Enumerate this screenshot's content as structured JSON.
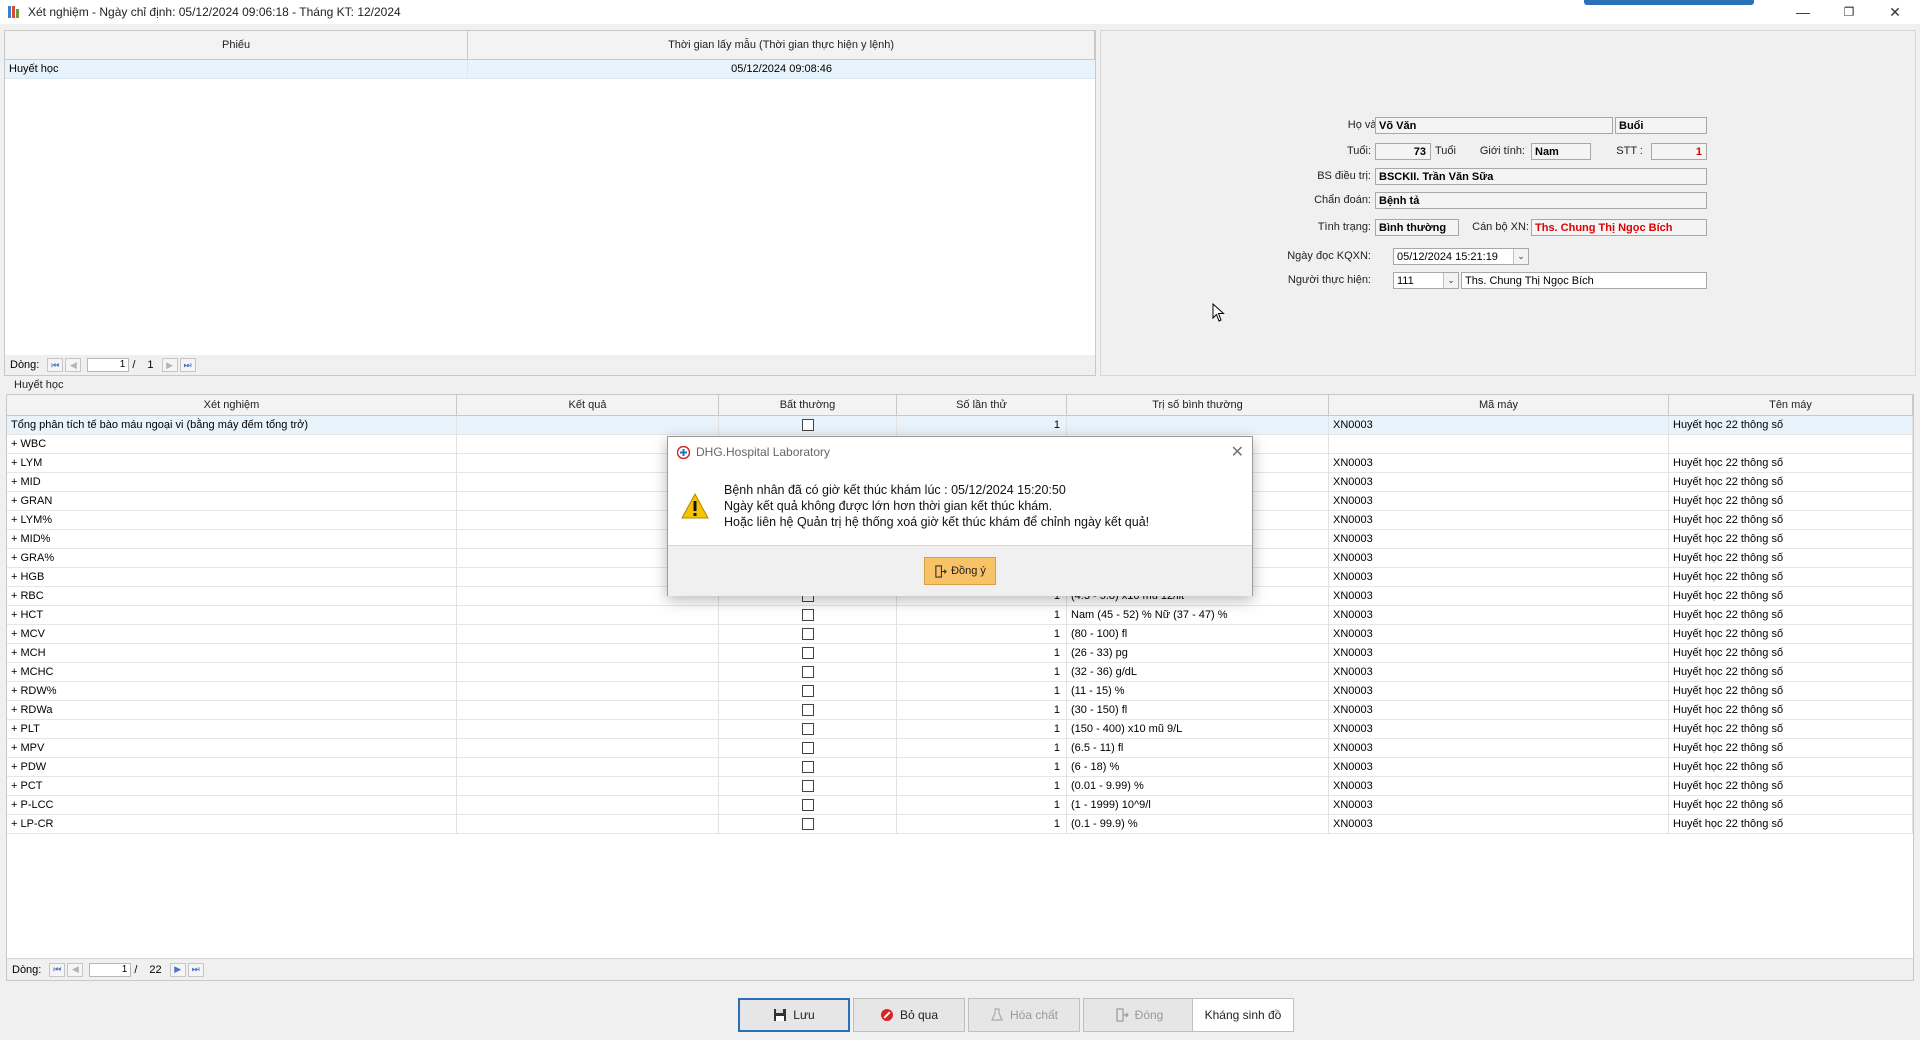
{
  "window": {
    "title": "Xét nghiệm - Ngày chỉ định: 05/12/2024 09:06:18 - Tháng KT: 12/2024",
    "minimize": "—",
    "restore": "❐",
    "close": "✕"
  },
  "top_grid": {
    "columns": [
      "Phiếu",
      "Thời gian lấy mẫu (Thời gian thực hiện y lệnh)"
    ],
    "rows": [
      {
        "phieu": "Huyết học",
        "time": "05/12/2024 09:08:46"
      }
    ],
    "pager": {
      "label": "Dòng:",
      "current": "1",
      "sep": "/",
      "total": "1"
    }
  },
  "patient": {
    "name_label": "Họ và tên :",
    "name": "Võ Văn",
    "session": "Buổi",
    "age_label": "Tuổi:",
    "age": "73",
    "age_unit": "Tuổi",
    "gender_label": "Giới tính:",
    "gender": "Nam",
    "stt_label": "STT :",
    "stt": "1",
    "doctor_label": "BS điều trị:",
    "doctor": "BSCKII. Trần Văn Sữa",
    "diagnosis_label": "Chẩn đoán:",
    "diagnosis": "Bệnh tả",
    "status_label": "Tình trạng:",
    "status": "Bình thường",
    "staff_label": "Cán bộ XN:",
    "staff": "Ths. Chung Thị Ngọc Bích",
    "read_date_label": "Ngày đọc KQXN:",
    "read_date": "05/12/2024  15:21:19",
    "performer_label": "Người thực hiện:",
    "performer_code": "111",
    "performer_name": "Ths. Chung Thị Ngọc Bích"
  },
  "section_label": "Huyết học",
  "main_grid": {
    "columns": [
      "Xét nghiệm",
      "Kết quả",
      "Bất thường",
      "Số lần thử",
      "Trị số bình thường",
      "Mã máy",
      "Tên máy"
    ],
    "rows": [
      {
        "test": "Tổng phân tích tế bào máu ngoại vi (bằng máy đếm tổng trở)",
        "count": "1",
        "normal": "",
        "machine": "XN0003",
        "machine_name": "Huyết học 22 thông số",
        "check": true
      },
      {
        "test": "+ WBC",
        "count": "",
        "normal": "",
        "machine": "",
        "machine_name": "",
        "check": false
      },
      {
        "test": "+ LYM",
        "count": "",
        "normal": "",
        "machine": "XN0003",
        "machine_name": "Huyết học 22 thông số",
        "check": false
      },
      {
        "test": "+ MID",
        "count": "",
        "normal": "",
        "machine": "XN0003",
        "machine_name": "Huyết học 22 thông số",
        "check": false
      },
      {
        "test": "+ GRAN",
        "count": "",
        "normal": "",
        "machine": "XN0003",
        "machine_name": "Huyết học 22 thông số",
        "check": false
      },
      {
        "test": "+ LYM%",
        "count": "",
        "normal": "",
        "machine": "XN0003",
        "machine_name": "Huyết học 22 thông số",
        "check": false
      },
      {
        "test": "+ MID%",
        "count": "",
        "normal": "",
        "machine": "XN0003",
        "machine_name": "Huyết học 22 thông số",
        "check": false
      },
      {
        "test": "+ GRA%",
        "count": "",
        "normal": "",
        "machine": "XN0003",
        "machine_name": "Huyết học 22 thông số",
        "check": false
      },
      {
        "test": "+ HGB",
        "count": "",
        "normal": "",
        "machine": "XN0003",
        "machine_name": "Huyết học 22 thông số",
        "check": false
      },
      {
        "test": "+ RBC",
        "count": "1",
        "normal": "(4.3 - 5.8) x10 mũ 12/lit",
        "machine": "XN0003",
        "machine_name": "Huyết học 22 thông số",
        "check": true
      },
      {
        "test": "+ HCT",
        "count": "1",
        "normal": "Nam (45 - 52) %  Nữ (37 - 47) %",
        "machine": "XN0003",
        "machine_name": "Huyết học 22 thông số",
        "check": true
      },
      {
        "test": "+ MCV",
        "count": "1",
        "normal": "(80 - 100) fl",
        "machine": "XN0003",
        "machine_name": "Huyết học 22 thông số",
        "check": true
      },
      {
        "test": "+ MCH",
        "count": "1",
        "normal": "(26 - 33) pg",
        "machine": "XN0003",
        "machine_name": "Huyết học 22 thông số",
        "check": true
      },
      {
        "test": "+ MCHC",
        "count": "1",
        "normal": "(32 - 36) g/dL",
        "machine": "XN0003",
        "machine_name": "Huyết học 22 thông số",
        "check": true
      },
      {
        "test": "+ RDW%",
        "count": "1",
        "normal": "(11 - 15) %",
        "machine": "XN0003",
        "machine_name": "Huyết học 22 thông số",
        "check": true
      },
      {
        "test": "+ RDWa",
        "count": "1",
        "normal": "(30 - 150) fl",
        "machine": "XN0003",
        "machine_name": "Huyết học 22 thông số",
        "check": true
      },
      {
        "test": "+ PLT",
        "count": "1",
        "normal": "(150 - 400) x10 mũ 9/L",
        "machine": "XN0003",
        "machine_name": "Huyết học 22 thông số",
        "check": true
      },
      {
        "test": "+ MPV",
        "count": "1",
        "normal": "(6.5 - 11) fl",
        "machine": "XN0003",
        "machine_name": "Huyết học 22 thông số",
        "check": true
      },
      {
        "test": "+ PDW",
        "count": "1",
        "normal": "(6 - 18) %",
        "machine": "XN0003",
        "machine_name": "Huyết học 22 thông số",
        "check": true
      },
      {
        "test": "+ PCT",
        "count": "1",
        "normal": "(0.01 - 9.99) %",
        "machine": "XN0003",
        "machine_name": "Huyết học 22 thông số",
        "check": true
      },
      {
        "test": "+ P-LCC",
        "count": "1",
        "normal": "(1 - 1999) 10^9/l",
        "machine": "XN0003",
        "machine_name": "Huyết học 22 thông số",
        "check": true
      },
      {
        "test": "+ LP-CR",
        "count": "1",
        "normal": "(0.1 - 99.9) %",
        "machine": "XN0003",
        "machine_name": "Huyết học 22 thông số",
        "check": true
      }
    ],
    "pager": {
      "label": "Dòng:",
      "current": "1",
      "sep": "/",
      "total": "22"
    }
  },
  "buttons": {
    "save": "Lưu",
    "skip": "Bỏ qua",
    "chemicals": "Hóa chất",
    "close": "Đóng",
    "antibiogram": "Kháng sinh đồ"
  },
  "dialog": {
    "title": "DHG.Hospital Laboratory",
    "close": "✕",
    "line1": "Bệnh nhân đã có giờ kết thúc khám lúc : 05/12/2024 15:20:50",
    "line2": "Ngày kết quả không được lớn hơn thời gian kết thúc khám.",
    "line3": "Hoặc liên hệ Quản trị hệ thống xoá giờ kết thúc khám để chỉnh ngày kết quả!",
    "ok": "Đồng ý"
  },
  "colors": {
    "accent": "#2a6fb8",
    "selected_row": "#e8f3fb",
    "warning_red": "#e00000",
    "ok_button": "#f8c266"
  }
}
